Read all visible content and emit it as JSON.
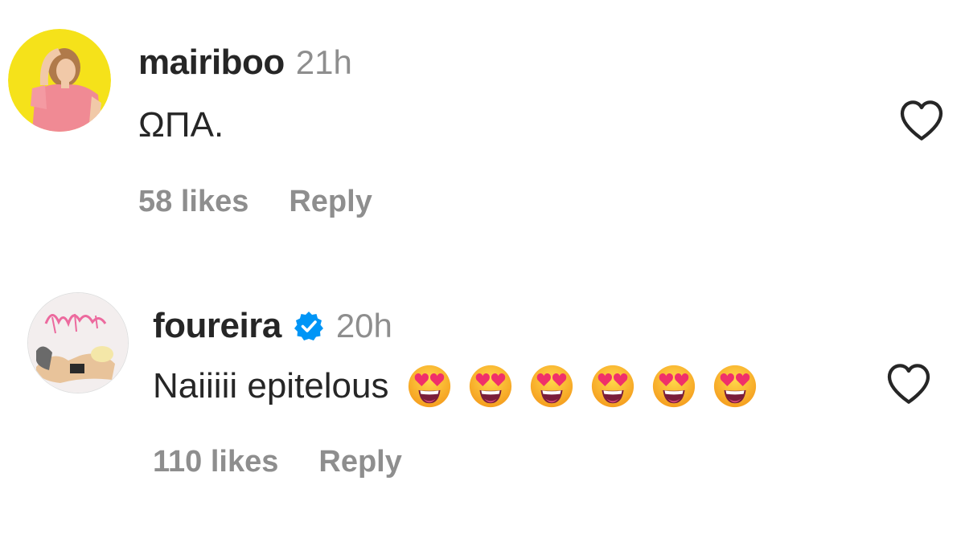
{
  "comments": [
    {
      "username": "mairiboo",
      "time": "21h",
      "text": "ΩΠΑ.",
      "likes": "58 likes",
      "reply": "Reply",
      "verified": false,
      "avatar_bg": "#f5e21a"
    },
    {
      "username": "foureira",
      "time": "20h",
      "text": "Naiiiii epitelous",
      "emoji_count": 6,
      "emoji": "smiling-face-with-heart-eyes",
      "likes": "110 likes",
      "reply": "Reply",
      "verified": true,
      "avatar_bg": "#f3eeee"
    }
  ],
  "colors": {
    "verified_badge": "#0095f6",
    "secondary_text": "#8e8e8e",
    "primary_text": "#262626"
  }
}
